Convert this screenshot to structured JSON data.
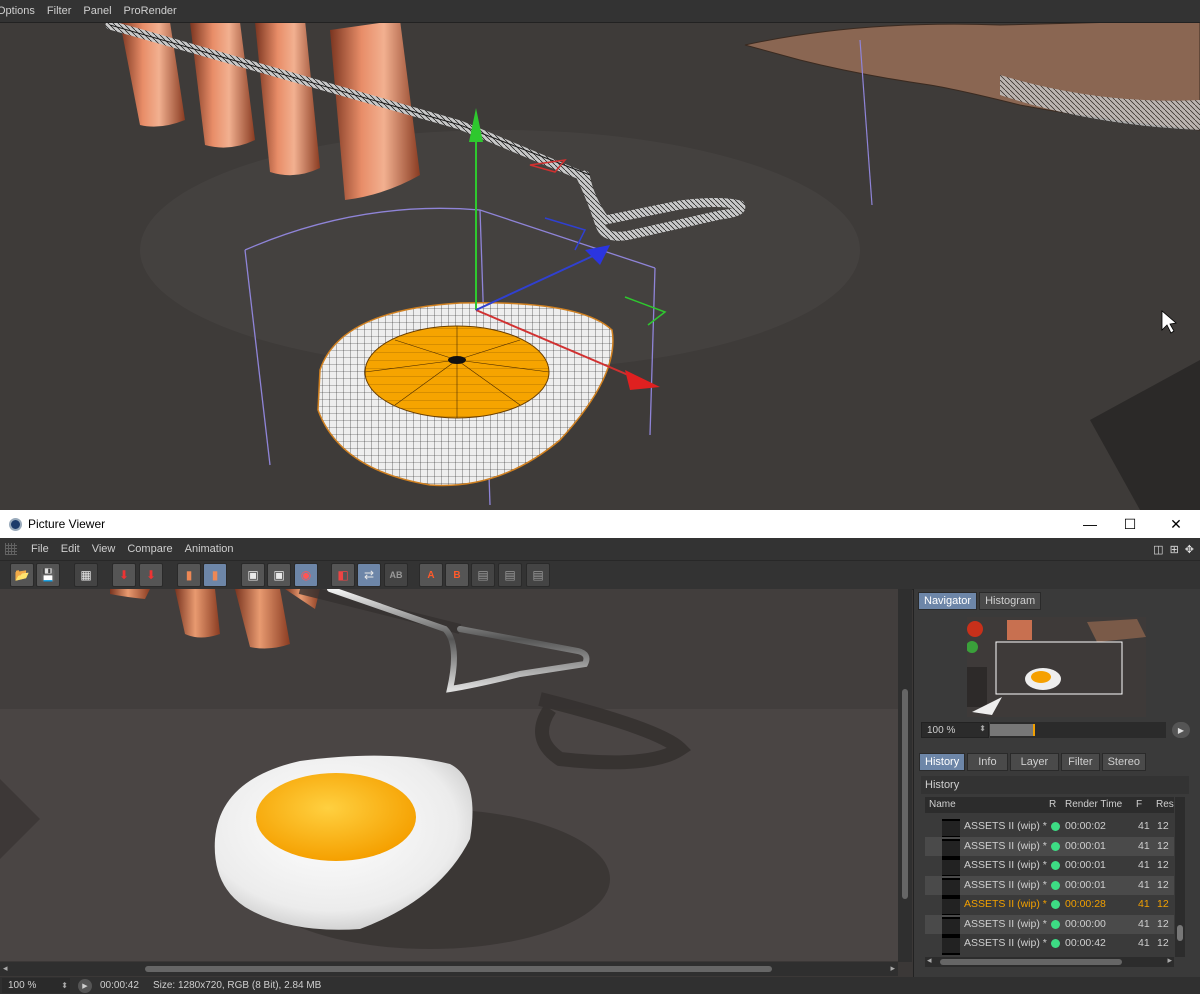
{
  "viewport_menu": [
    "Options",
    "Filter",
    "Panel",
    "ProRender"
  ],
  "window": {
    "title": "Picture Viewer",
    "minimize": "—",
    "maximize": "☐",
    "close": "✕"
  },
  "menu": [
    "File",
    "Edit",
    "View",
    "Compare",
    "Animation"
  ],
  "toolbar": {
    "ab_label": "AB",
    "a_label": "A",
    "b_label": "B"
  },
  "navigator": {
    "tabs": [
      "Navigator",
      "Histogram"
    ],
    "zoom": "100 %",
    "zoom_fraction": 0.25
  },
  "side_tabs": [
    "History",
    "Info",
    "Layer",
    "Filter",
    "Stereo"
  ],
  "history": {
    "label": "History",
    "columns": [
      "Name",
      "R",
      "Render Time",
      "F",
      "Res"
    ],
    "rows": [
      {
        "name": "ASSETS II (wip) *",
        "time": "00:00:02",
        "frame": "41",
        "res": "12"
      },
      {
        "name": "ASSETS II (wip) *",
        "time": "00:00:01",
        "frame": "41",
        "res": "12"
      },
      {
        "name": "ASSETS II (wip) *",
        "time": "00:00:01",
        "frame": "41",
        "res": "12"
      },
      {
        "name": "ASSETS II (wip) *",
        "time": "00:00:01",
        "frame": "41",
        "res": "12"
      },
      {
        "name": "ASSETS II (wip) *",
        "time": "00:00:28",
        "frame": "41",
        "res": "12"
      },
      {
        "name": "ASSETS II (wip) *",
        "time": "00:00:00",
        "frame": "41",
        "res": "12"
      },
      {
        "name": "ASSETS II (wip) *",
        "time": "00:00:42",
        "frame": "41",
        "res": "12"
      }
    ],
    "dot_color": "#3ddc84",
    "selected_color": "#f2a000"
  },
  "status": {
    "zoom": "100 %",
    "time": "00:00:42",
    "size": "Size: 1280x720, RGB (8 Bit), 2.84 MB"
  }
}
